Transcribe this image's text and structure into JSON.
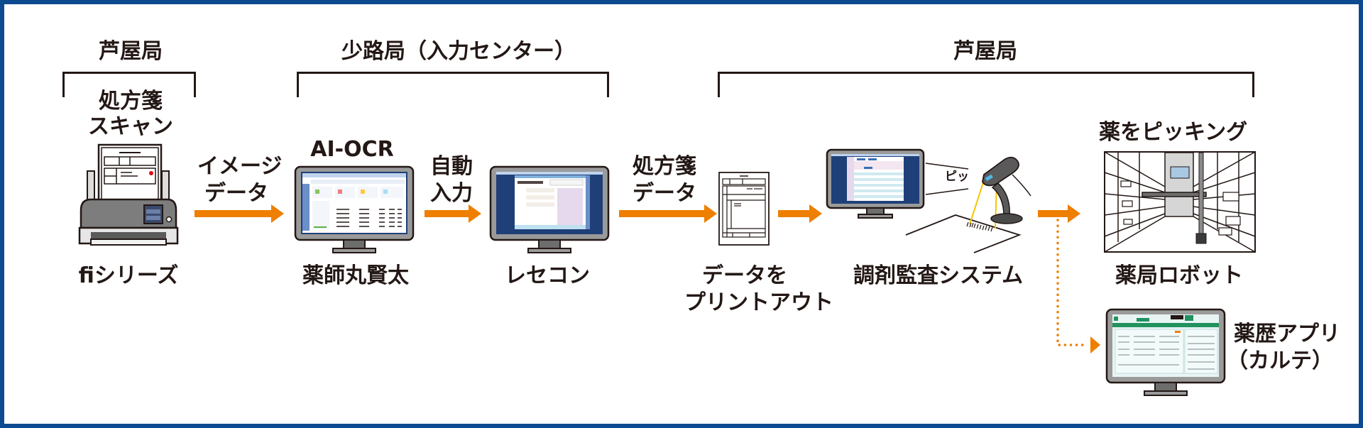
{
  "diagram": {
    "groups": [
      {
        "label": "芦屋局"
      },
      {
        "label": "少路局（入力センター）"
      },
      {
        "label": "芦屋局"
      }
    ],
    "nodes": {
      "scan_caption": [
        "処方箋",
        "スキャン"
      ],
      "scanner_label": "fiシリーズ",
      "ocr_caption": "AI-OCR",
      "ocr_label": "薬師丸賢太",
      "rececon_label": "レセコン",
      "printout_label": [
        "データを",
        "プリントアウト"
      ],
      "audit_label": "調剤監査システム",
      "beep_text": "ピッ",
      "picking_caption": "薬をピッキング",
      "robot_label": "薬局ロボット",
      "history_label": [
        "薬歴アプリ",
        "（カルテ）"
      ]
    },
    "edges": [
      {
        "from": "scanner",
        "to": "ocr",
        "label": [
          "イメージ",
          "データ"
        ],
        "style": "solid"
      },
      {
        "from": "ocr",
        "to": "rececon",
        "label": [
          "自動",
          "入力"
        ],
        "style": "solid"
      },
      {
        "from": "rececon",
        "to": "printout",
        "label": [
          "処方箋",
          "データ"
        ],
        "style": "solid"
      },
      {
        "from": "printout",
        "to": "audit",
        "label": [],
        "style": "solid"
      },
      {
        "from": "audit",
        "to": "robot",
        "label": [],
        "style": "solid"
      },
      {
        "from": "audit",
        "to": "history_app",
        "label": [],
        "style": "dotted"
      }
    ],
    "colors": {
      "border": "#0d4a8f",
      "arrow": "#ee7f00",
      "text": "#231815"
    }
  }
}
